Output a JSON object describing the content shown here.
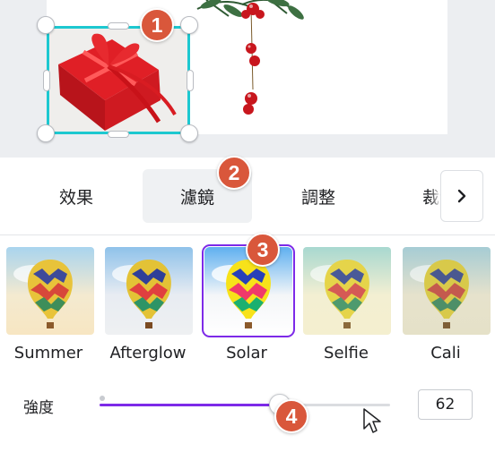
{
  "tabs": [
    {
      "label": "效果"
    },
    {
      "label": "濾鏡"
    },
    {
      "label": "調整"
    },
    {
      "label": "裁切"
    }
  ],
  "active_tab": "濾鏡",
  "filters": [
    {
      "label": "Summer"
    },
    {
      "label": "Afterglow"
    },
    {
      "label": "Solar"
    },
    {
      "label": "Selfie"
    },
    {
      "label": "Cali"
    }
  ],
  "selected_filter": "Solar",
  "intensity": {
    "label": "強度",
    "value": "62",
    "fraction": 0.62
  },
  "badges": [
    "1",
    "2",
    "3",
    "4"
  ],
  "icons": {
    "scroll_right": "chevron-right-icon",
    "cursor": "mouse-pointer-icon"
  },
  "colors": {
    "accent": "#7d2ae8",
    "badge": "#d9573b",
    "selection": "#1dc8d0"
  }
}
